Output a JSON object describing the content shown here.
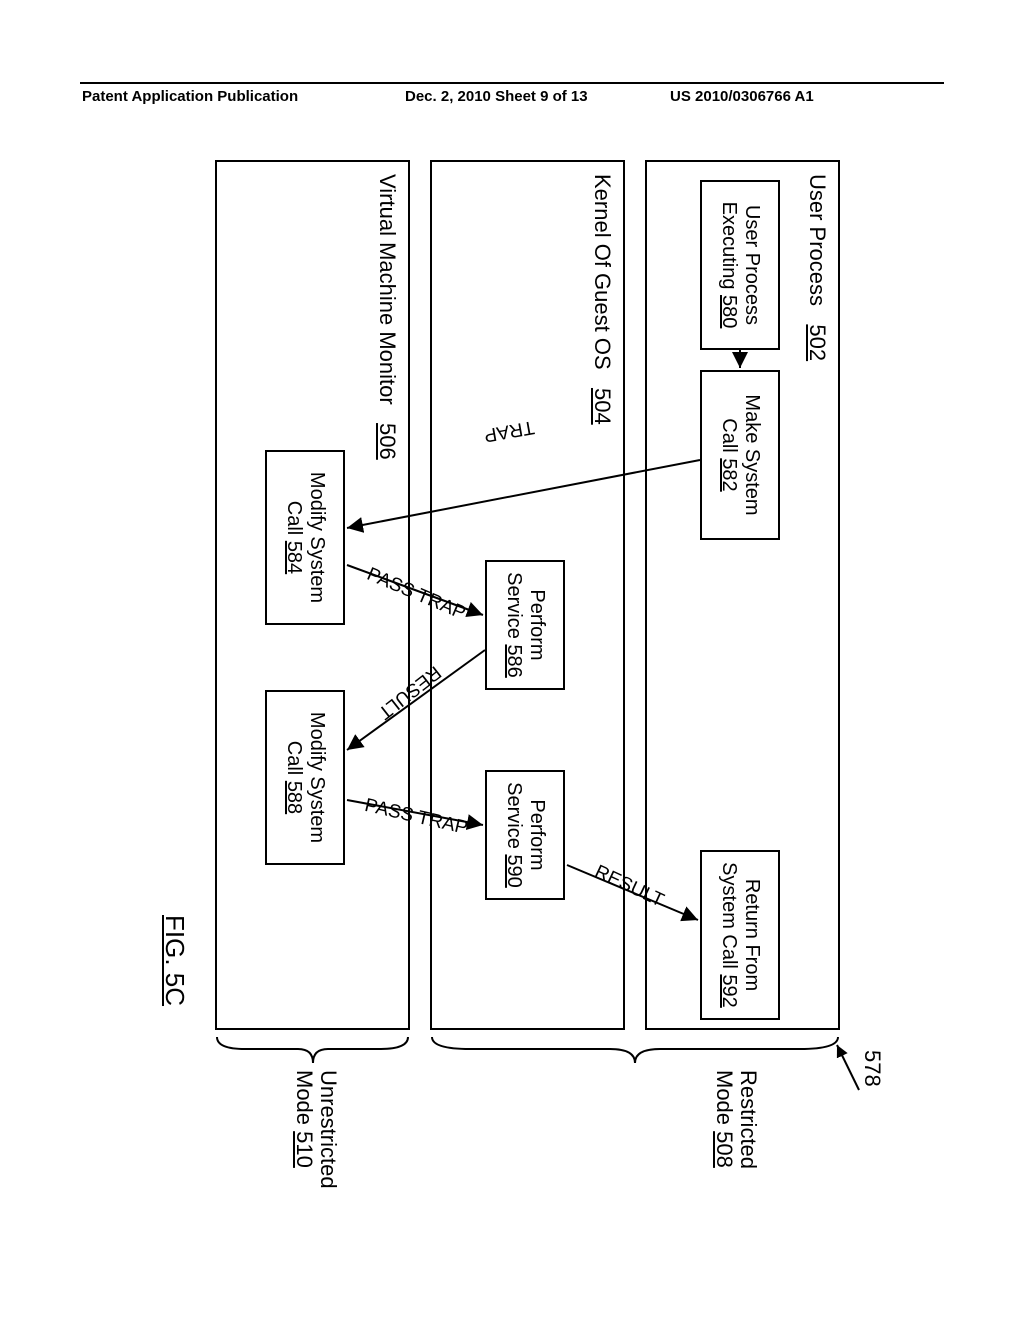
{
  "header": {
    "left": "Patent Application Publication",
    "center": "Dec. 2, 2010  Sheet 9 of 13",
    "right": "US 2010/0306766 A1"
  },
  "ref_number": "578",
  "lanes": {
    "user": {
      "title_text": "User Process",
      "title_num": "502"
    },
    "kernel": {
      "title_text": "Kernel Of Guest OS",
      "title_num": "504"
    },
    "vmm": {
      "title_text": "Virtual Machine Monitor",
      "title_num": "506"
    }
  },
  "steps": {
    "s580": {
      "text": "User Process\nExecuting",
      "num": "580"
    },
    "s582": {
      "text": "Make System\nCall",
      "num": "582"
    },
    "s584": {
      "text": "Modify System\nCall",
      "num": "584"
    },
    "s586": {
      "text": "Perform\nService",
      "num": "586"
    },
    "s588": {
      "text": "Modify System\nCall",
      "num": "588"
    },
    "s590": {
      "text": "Perform\nService",
      "num": "590"
    },
    "s592": {
      "text": "Return From\nSystem Call",
      "num": "592"
    }
  },
  "edges": {
    "e1": "TRAP",
    "e2": "PASS TRAP",
    "e3": "RESULT",
    "e4": "PASS TRAP",
    "e5": "RESULT"
  },
  "modes": {
    "restricted": {
      "l1": "Restricted",
      "l2": "Mode",
      "num": "508"
    },
    "unrestricted": {
      "l1": "Unrestricted",
      "l2": "Mode",
      "num": "510"
    }
  },
  "figure_label": "FIG. 5C"
}
